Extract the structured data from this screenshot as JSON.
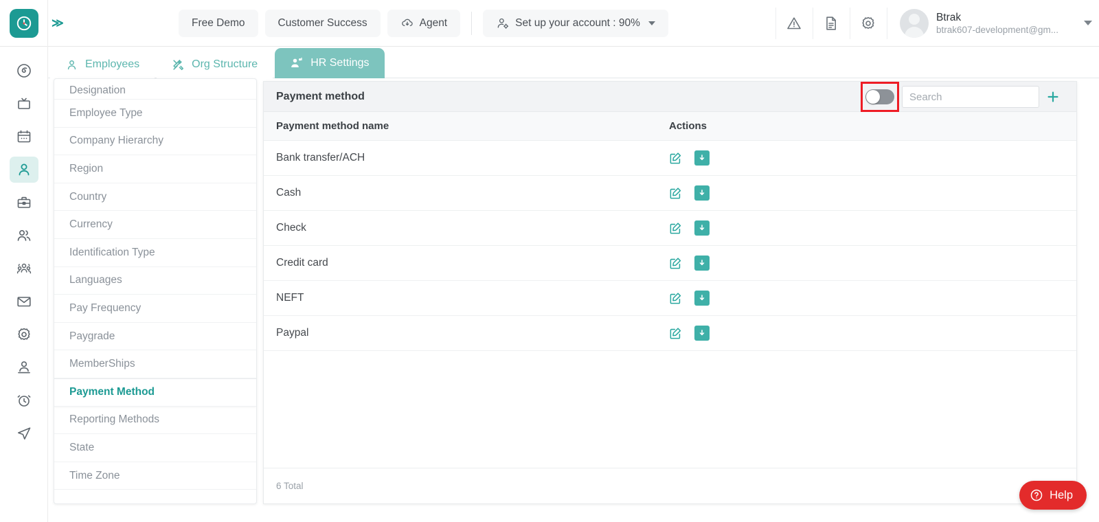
{
  "app": {
    "logo_icon": "clock-logo-icon",
    "expand_icon": "chevrons-right-icon",
    "expand_label": "≫"
  },
  "header": {
    "buttons": [
      {
        "label": "Free Demo",
        "icon": null,
        "name": "free-demo-button"
      },
      {
        "label": "Customer Success",
        "icon": null,
        "name": "customer-success-button"
      },
      {
        "label": "Agent",
        "icon": "cloud-download-icon",
        "name": "agent-button"
      }
    ],
    "account_setup": {
      "label": "Set up your account : 90%",
      "icon": "user-gear-icon",
      "percent": "90%"
    },
    "icons": [
      {
        "name": "warning-triangle-icon"
      },
      {
        "name": "document-icon"
      },
      {
        "name": "gear-icon"
      }
    ],
    "user": {
      "name": "Btrak",
      "email": "btrak607-development@gm...",
      "avatar_icon": "avatar-placeholder-icon"
    }
  },
  "rail": {
    "items": [
      {
        "name": "dashboard-icon",
        "active": false
      },
      {
        "name": "tv-icon",
        "active": false
      },
      {
        "name": "calendar-icon",
        "active": false
      },
      {
        "name": "user-icon",
        "active": true
      },
      {
        "name": "briefcase-icon",
        "active": false
      },
      {
        "name": "users-icon",
        "active": false
      },
      {
        "name": "team-group-icon",
        "active": false
      },
      {
        "name": "mail-icon",
        "active": false
      },
      {
        "name": "gear-icon",
        "active": false
      },
      {
        "name": "person-badge-icon",
        "active": false
      },
      {
        "name": "alarm-clock-icon",
        "active": false
      },
      {
        "name": "send-navigation-icon",
        "active": false
      }
    ]
  },
  "tabs": [
    {
      "label": "Employees",
      "icon": "person-icon",
      "active": false
    },
    {
      "label": "Org Structure",
      "icon": "tools-icon",
      "active": false
    },
    {
      "label": "HR Settings",
      "icon": "people-settings-icon",
      "active": true
    }
  ],
  "settings_list": [
    {
      "label": "Designation",
      "selected": false
    },
    {
      "label": "Employee Type",
      "selected": false
    },
    {
      "label": "Company Hierarchy",
      "selected": false
    },
    {
      "label": "Region",
      "selected": false
    },
    {
      "label": "Country",
      "selected": false
    },
    {
      "label": "Currency",
      "selected": false
    },
    {
      "label": "Identification Type",
      "selected": false
    },
    {
      "label": "Languages",
      "selected": false
    },
    {
      "label": "Pay Frequency",
      "selected": false
    },
    {
      "label": "Paygrade",
      "selected": false
    },
    {
      "label": "MemberShips",
      "selected": false
    },
    {
      "label": "Payment Method",
      "selected": true
    },
    {
      "label": "Reporting Methods",
      "selected": false
    },
    {
      "label": "State",
      "selected": false
    },
    {
      "label": "Time Zone",
      "selected": false
    }
  ],
  "panel": {
    "title": "Payment method",
    "toggle": {
      "state": "off",
      "highlighted": true
    },
    "search": {
      "value": "",
      "placeholder": "Search"
    },
    "add_label": "+",
    "columns": {
      "name": "Payment method name",
      "actions": "Actions"
    },
    "rows": [
      {
        "name": "Bank transfer/ACH"
      },
      {
        "name": "Cash"
      },
      {
        "name": "Check"
      },
      {
        "name": "Credit card"
      },
      {
        "name": "NEFT"
      },
      {
        "name": "Paypal"
      }
    ],
    "footer_total": "6 Total"
  },
  "help": {
    "label": "Help",
    "icon": "question-circle-icon"
  },
  "colors": {
    "brand_teal": "#1c9a93",
    "tab_active": "#7dc4be",
    "accent_icon": "#3fb0a8",
    "highlight_red": "#ee1c25",
    "help_red": "#e32b2b"
  }
}
